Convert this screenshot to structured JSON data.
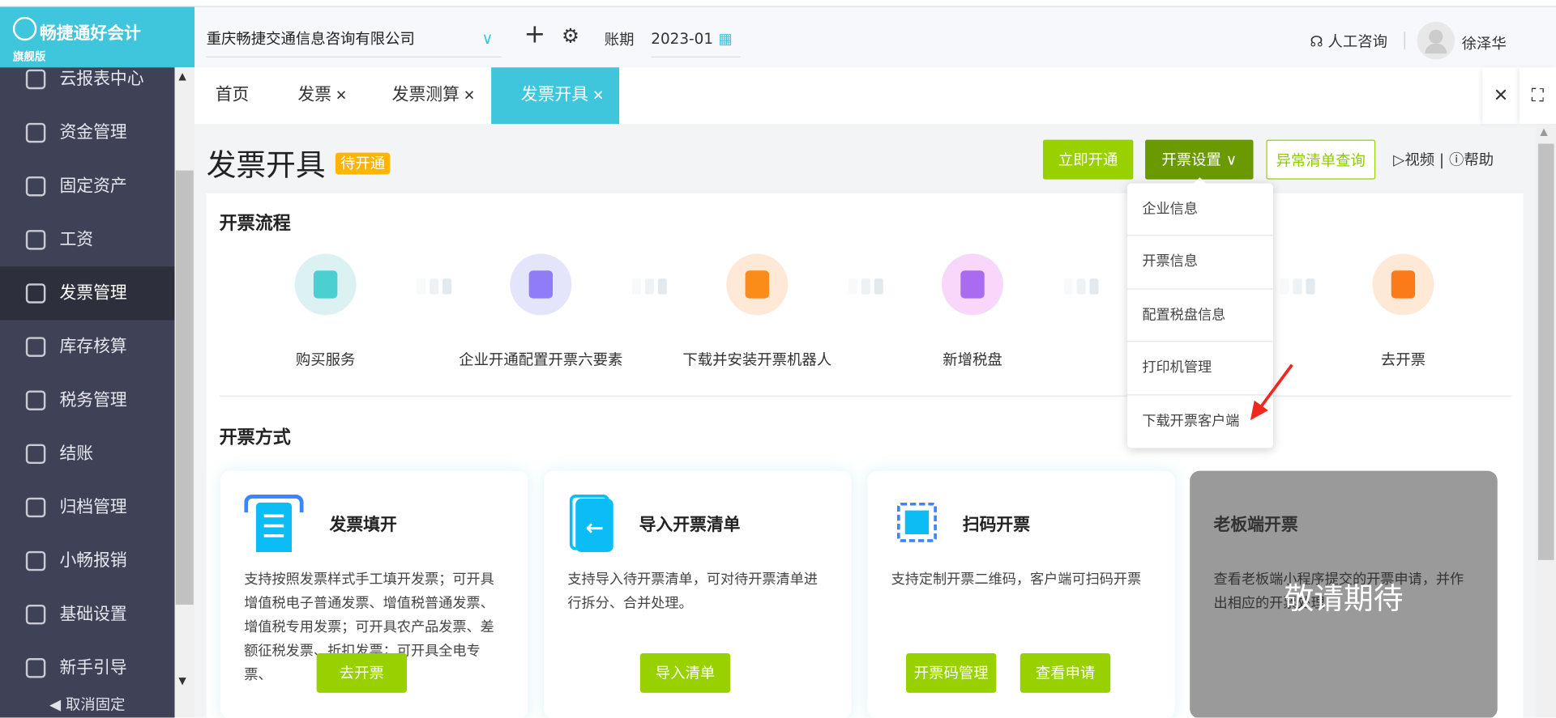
{
  "app": {
    "name": "畅捷通好会计",
    "edition": "旗舰版"
  },
  "header": {
    "company": "重庆畅捷交通信息咨询有限公司",
    "period_label": "账期",
    "period": "2023-01",
    "consult": "人工咨询",
    "user": "徐泽华"
  },
  "sidebar": {
    "items": [
      {
        "label": "云报表中心",
        "icon": "chart-icon"
      },
      {
        "label": "资金管理",
        "icon": "money-bag-icon"
      },
      {
        "label": "固定资产",
        "icon": "building-icon"
      },
      {
        "label": "工资",
        "icon": "salary-icon"
      },
      {
        "label": "发票管理",
        "icon": "invoice-icon",
        "active": true
      },
      {
        "label": "库存核算",
        "icon": "warehouse-icon"
      },
      {
        "label": "税务管理",
        "icon": "tax-icon"
      },
      {
        "label": "结账",
        "icon": "checkout-icon"
      },
      {
        "label": "归档管理",
        "icon": "archive-icon"
      },
      {
        "label": "小畅报销",
        "icon": "reimburse-icon"
      },
      {
        "label": "基础设置",
        "icon": "gear-icon"
      },
      {
        "label": "新手引导",
        "icon": "guide-icon"
      }
    ],
    "unpin": "取消固定"
  },
  "tabs": [
    {
      "label": "首页"
    },
    {
      "label": "发票",
      "closable": true
    },
    {
      "label": "发票测算",
      "closable": true
    },
    {
      "label": "发票开具",
      "closable": true,
      "active": true
    }
  ],
  "page": {
    "title": "发票开具",
    "badge": "待开通",
    "actions": {
      "activate": "立即开通",
      "settings": "开票设置",
      "abnormal": "异常清单查询",
      "video": "视频",
      "help": "帮助"
    }
  },
  "dropdown": {
    "items": [
      "企业信息",
      "开票信息",
      "配置税盘信息",
      "打印机管理",
      "下载开票客户端"
    ]
  },
  "flow": {
    "title": "开票流程",
    "steps": [
      "购买服务",
      "企业开通配置开票六要素",
      "下载并安装开票机器人",
      "新增税盘",
      "去开票"
    ]
  },
  "methods": {
    "title": "开票方式",
    "cards": [
      {
        "title": "发票填开",
        "desc": "支持按照发票样式手工填开发票；可开具增值税电子普通发票、增值税普通发票、增值税专用发票；可开具农产品发票、差额征税发票、折扣发票；可开具全电专票、",
        "buttons": [
          "去开票"
        ]
      },
      {
        "title": "导入开票清单",
        "desc": "支持导入待开票清单，可对待开票清单进行拆分、合并处理。",
        "buttons": [
          "导入清单"
        ]
      },
      {
        "title": "扫码开票",
        "desc": "支持定制开票二维码，客户端可扫码开票",
        "buttons": [
          "开票码管理",
          "查看申请"
        ]
      },
      {
        "title": "老板端开票",
        "desc": "查看老板端小程序提交的开票申请，并作出相应的开票处理",
        "overlay": "敬请期待"
      }
    ]
  },
  "colors": {
    "brand": "#3fc6dc",
    "primary_green": "#99d100",
    "dark_green": "#6a9a00",
    "badge": "#ffb400",
    "sidebar": "#3f4156"
  }
}
